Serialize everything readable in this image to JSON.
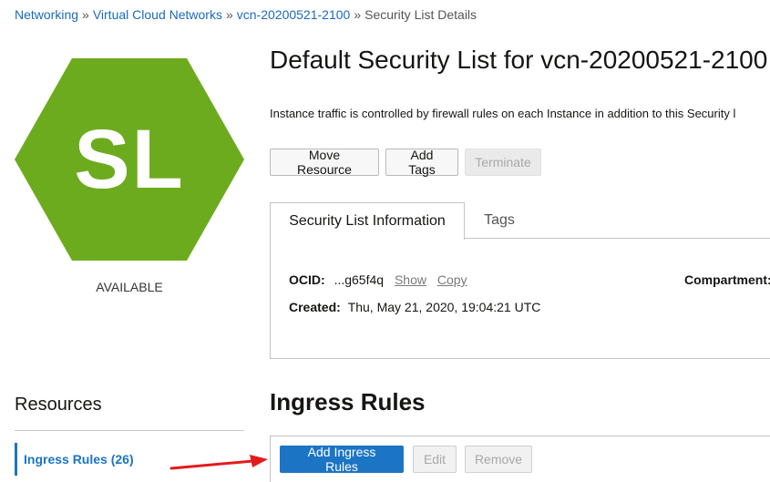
{
  "breadcrumb": {
    "items": [
      "Networking",
      "Virtual Cloud Networks",
      "vcn-20200521-2100"
    ],
    "separator": "»",
    "current": "Security List Details"
  },
  "badge": {
    "initials": "SL",
    "status": "AVAILABLE",
    "color": "#6dab1e"
  },
  "header": {
    "title": "Default Security List for vcn-20200521-2100",
    "description": "Instance traffic is controlled by firewall rules on each Instance in addition to this Security l"
  },
  "actions": {
    "move_resource": "Move Resource",
    "add_tags": "Add Tags",
    "terminate": "Terminate"
  },
  "tabs": {
    "info": "Security List Information",
    "tags": "Tags"
  },
  "info": {
    "ocid_label": "OCID:",
    "ocid_value": "...g65f4q",
    "show": "Show",
    "copy": "Copy",
    "compartment_label": "Compartment:",
    "created_label": "Created:",
    "created_value": "Thu, May 21, 2020, 19:04:21 UTC"
  },
  "resources": {
    "title": "Resources",
    "items": [
      "Ingress Rules (26)"
    ]
  },
  "ingress": {
    "title": "Ingress Rules",
    "add": "Add Ingress Rules",
    "edit": "Edit",
    "remove": "Remove"
  },
  "colors": {
    "link": "#1a6bbd",
    "primary": "#1b74c4",
    "annotation_arrow": "#e31b1b"
  }
}
